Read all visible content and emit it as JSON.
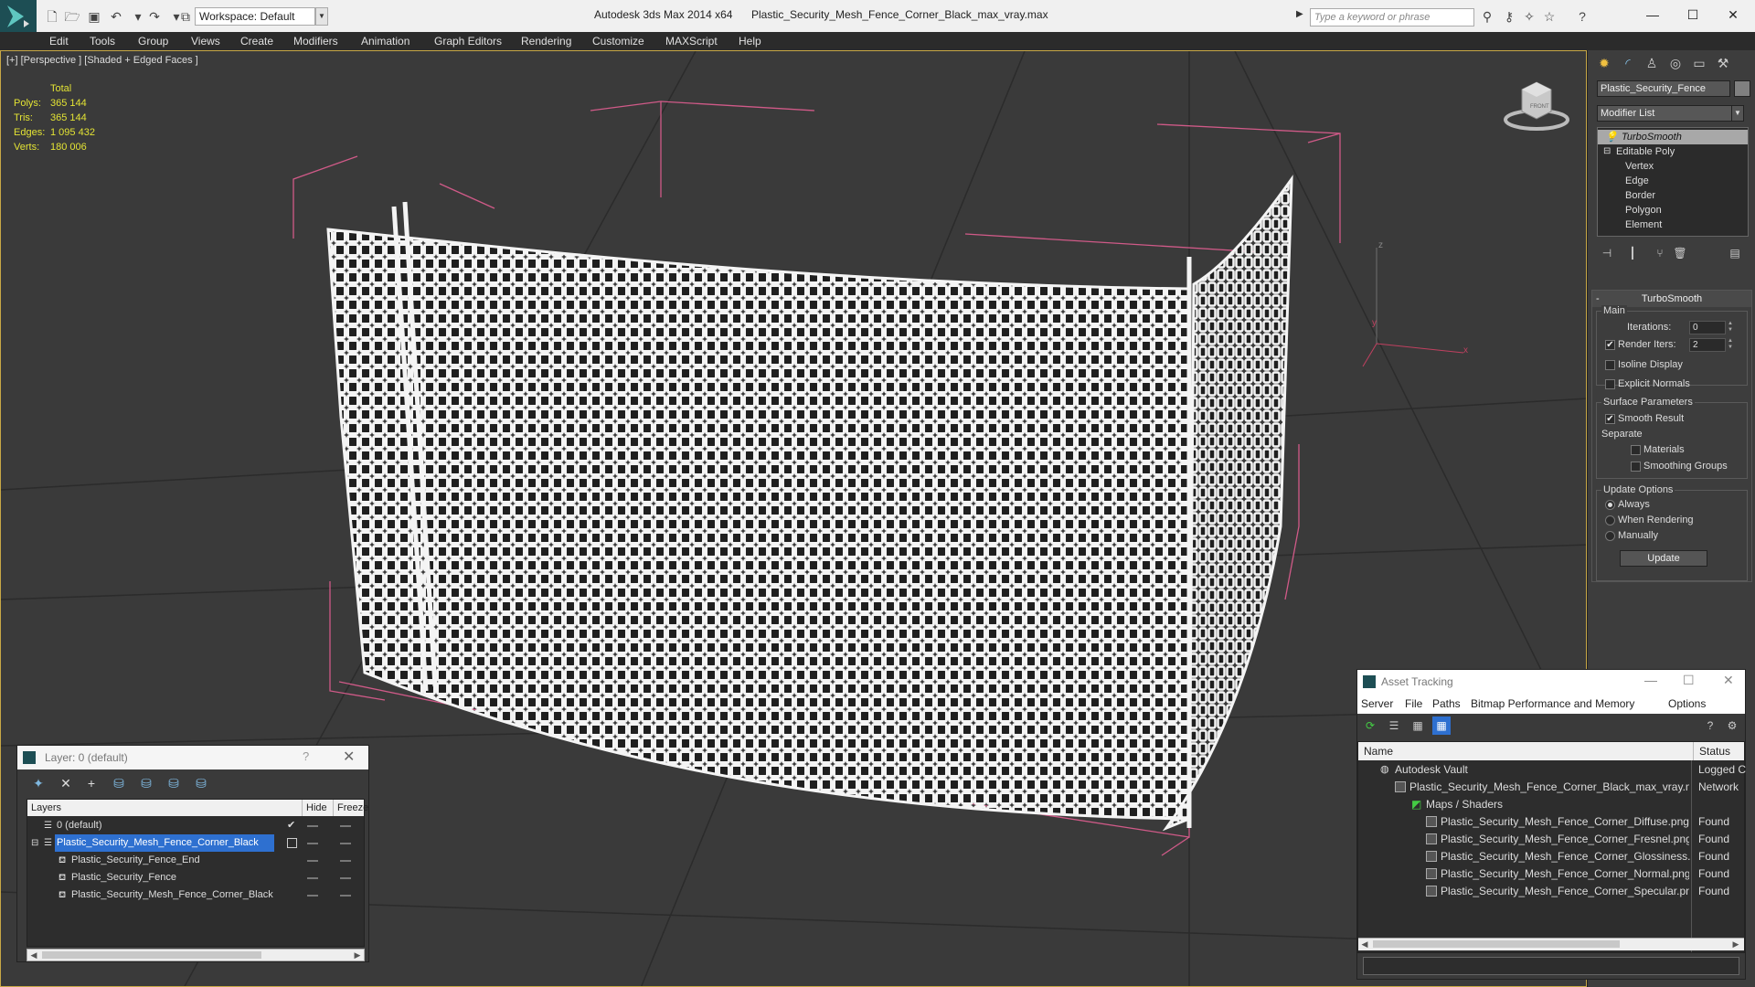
{
  "titlebar": {
    "workspace": "Workspace: Default",
    "app_title": "Autodesk 3ds Max  2014 x64",
    "file_title": "Plastic_Security_Mesh_Fence_Corner_Black_max_vray.max",
    "search_placeholder": "Type a keyword or phrase"
  },
  "menu": [
    "Edit",
    "Tools",
    "Group",
    "Views",
    "Create",
    "Modifiers",
    "Animation",
    "Graph Editors",
    "Rendering",
    "Customize",
    "MAXScript",
    "Help"
  ],
  "viewport": {
    "label": "[+] [Perspective ] [Shaded + Edged Faces ]",
    "stats": {
      "total_label": "Total",
      "rows": [
        {
          "label": "Polys:",
          "value": "365 144"
        },
        {
          "label": "Tris:",
          "value": "365 144"
        },
        {
          "label": "Edges:",
          "value": "1 095 432"
        },
        {
          "label": "Verts:",
          "value": "180 006"
        }
      ]
    },
    "viewcube_label": "FRONT",
    "axis_x": "x",
    "axis_y": "y",
    "axis_z": "z"
  },
  "command_panel": {
    "object_name": "Plastic_Security_Fence",
    "modifier_list": "Modifier List",
    "stack": [
      {
        "label": "TurboSmooth",
        "selected": true
      },
      {
        "label": "Editable Poly"
      },
      {
        "label": "Vertex",
        "sub": true
      },
      {
        "label": "Edge",
        "sub": true
      },
      {
        "label": "Border",
        "sub": true
      },
      {
        "label": "Polygon",
        "sub": true
      },
      {
        "label": "Element",
        "sub": true
      }
    ],
    "turbosmooth": {
      "collapse": "-",
      "header": "TurboSmooth",
      "main": "Main",
      "iterations_label": "Iterations:",
      "iterations_value": "0",
      "render_iters_label": "Render Iters:",
      "render_iters_value": "2",
      "isoline": "Isoline Display",
      "explicit_normals": "Explicit Normals",
      "surface_params": "Surface Parameters",
      "smooth_result": "Smooth Result",
      "separate": "Separate",
      "materials": "Materials",
      "smoothing_groups": "Smoothing Groups",
      "update_options": "Update Options",
      "always": "Always",
      "when_rendering": "When Rendering",
      "manually": "Manually",
      "update_btn": "Update"
    }
  },
  "layer_dialog": {
    "title": "Layer: 0 (default)",
    "help": "?",
    "close": "✕",
    "col_layers": "Layers",
    "col_hide": "Hide",
    "col_freeze": "Freeze",
    "rows": [
      {
        "name": "0 (default)",
        "indent": 0,
        "check": true
      },
      {
        "name": "Plastic_Security_Mesh_Fence_Corner_Black",
        "indent": 0,
        "selected": true
      },
      {
        "name": "Plastic_Security_Fence_End",
        "indent": 1
      },
      {
        "name": "Plastic_Security_Fence",
        "indent": 1
      },
      {
        "name": "Plastic_Security_Mesh_Fence_Corner_Black",
        "indent": 1
      }
    ]
  },
  "asset_dialog": {
    "title": "Asset Tracking",
    "menu": [
      "Server",
      "File",
      "Paths",
      "Bitmap Performance and Memory",
      "Options"
    ],
    "col_name": "Name",
    "col_status": "Status",
    "rows": [
      {
        "name": "Autodesk Vault",
        "status": "Logged C",
        "indent": 0
      },
      {
        "name": "Plastic_Security_Mesh_Fence_Corner_Black_max_vray.max",
        "status": "Network",
        "indent": 1
      },
      {
        "name": "Maps / Shaders",
        "status": "",
        "indent": 2
      },
      {
        "name": "Plastic_Security_Mesh_Fence_Corner_Diffuse.png",
        "status": "Found",
        "indent": 3
      },
      {
        "name": "Plastic_Security_Mesh_Fence_Corner_Fresnel.png",
        "status": "Found",
        "indent": 3
      },
      {
        "name": "Plastic_Security_Mesh_Fence_Corner_Glossiness.png",
        "status": "Found",
        "indent": 3
      },
      {
        "name": "Plastic_Security_Mesh_Fence_Corner_Normal.png",
        "status": "Found",
        "indent": 3
      },
      {
        "name": "Plastic_Security_Mesh_Fence_Corner_Specular.png",
        "status": "Found",
        "indent": 3
      }
    ]
  }
}
